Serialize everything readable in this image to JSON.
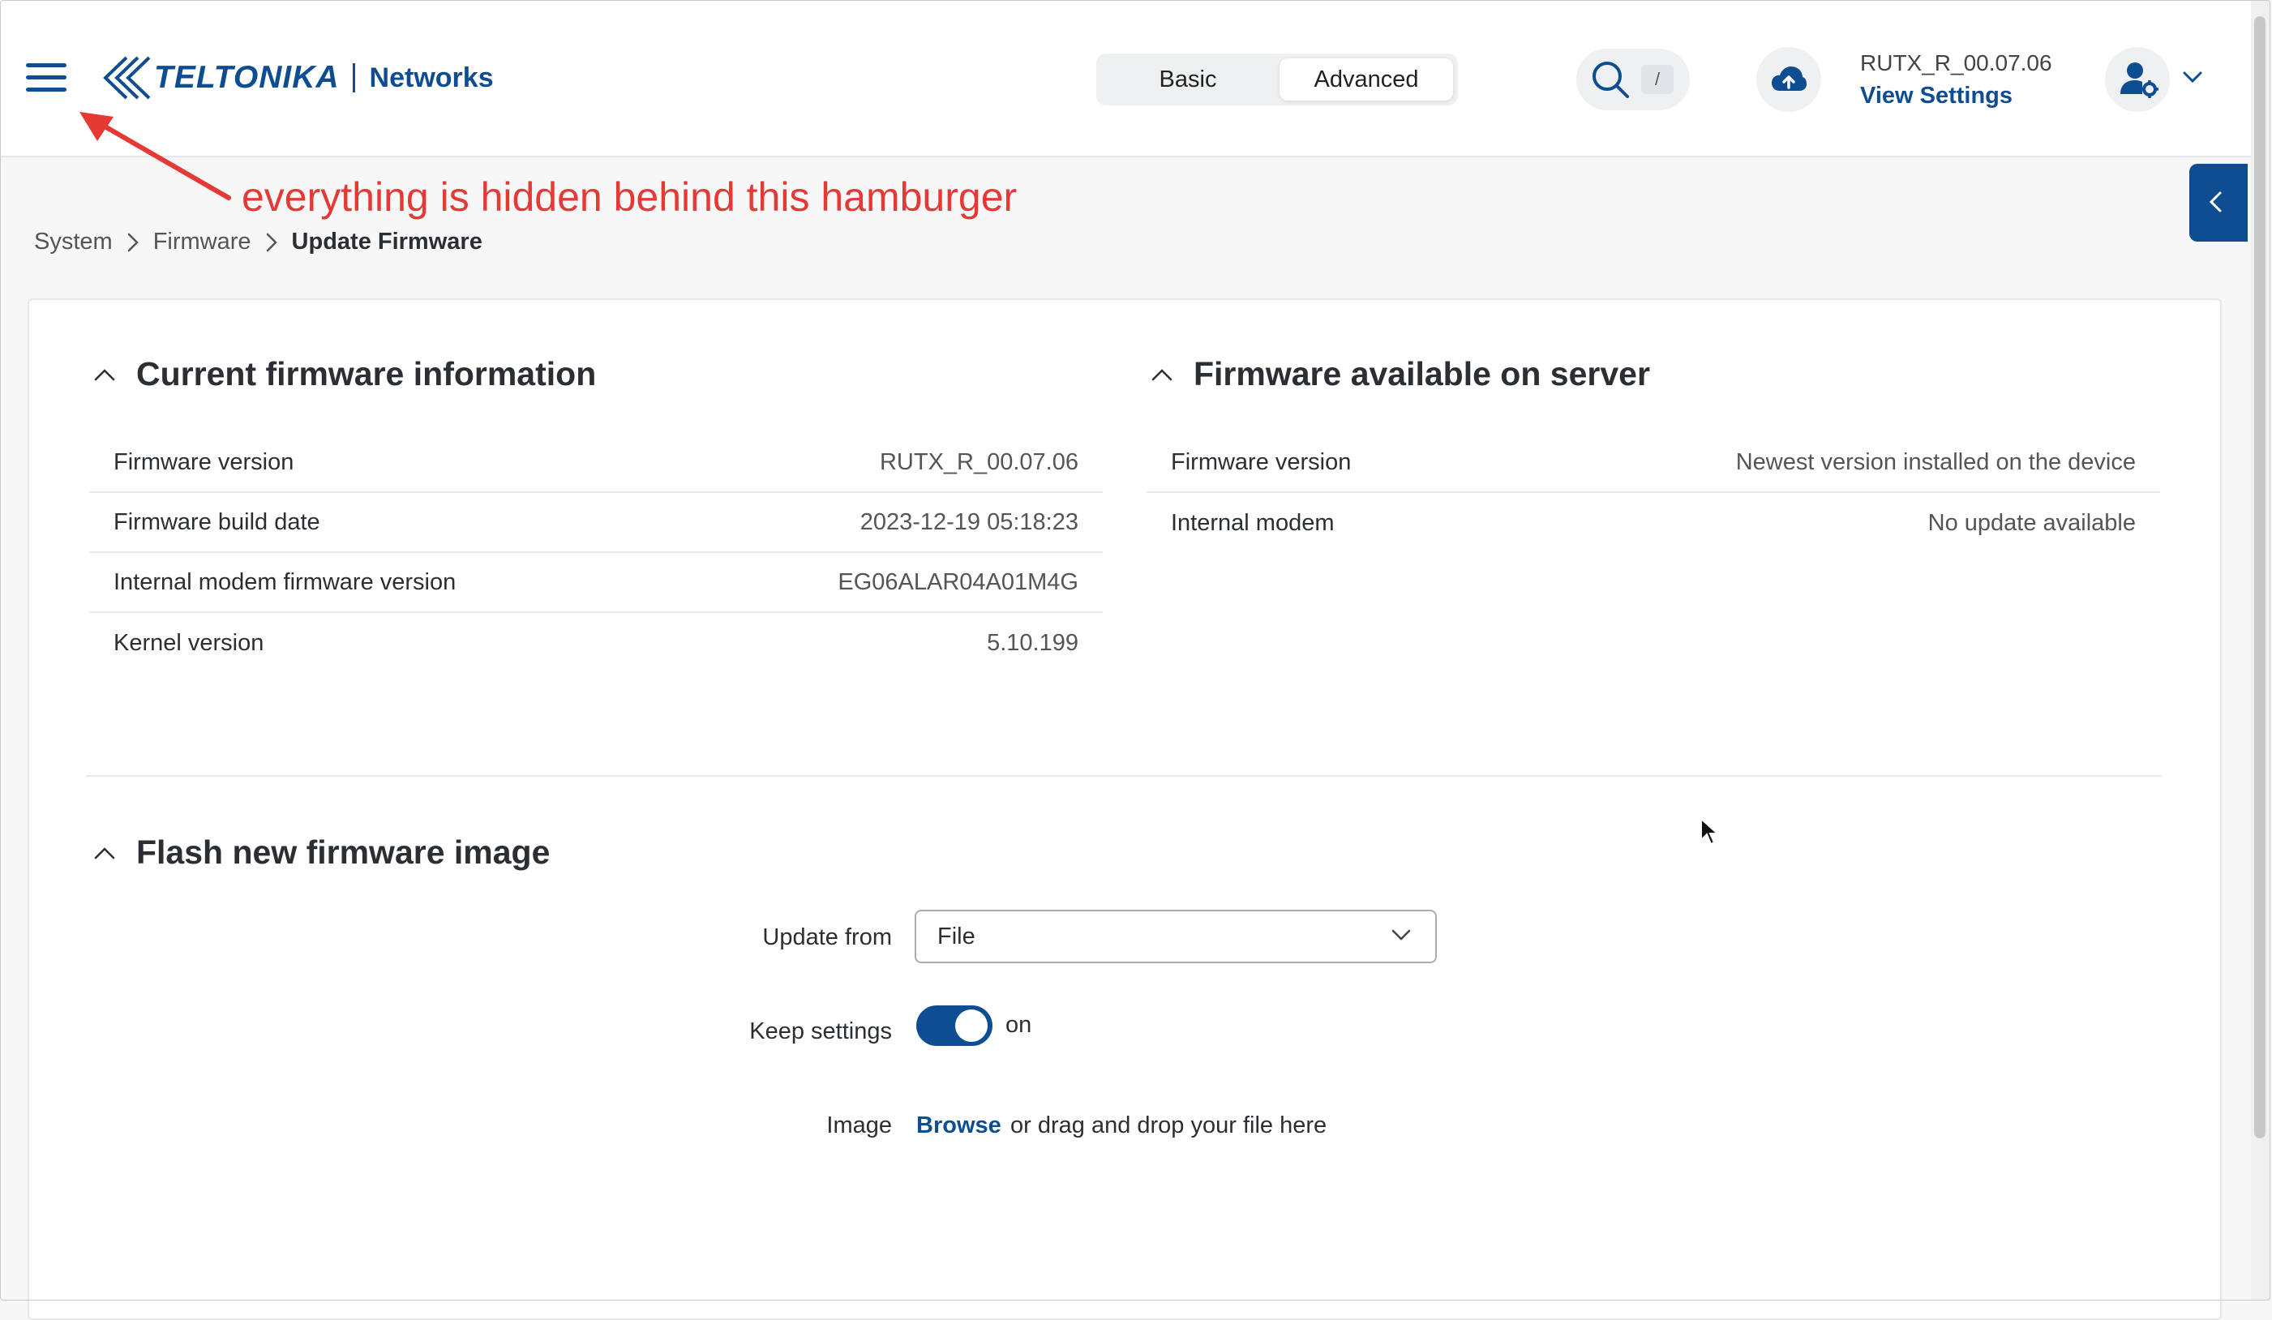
{
  "header": {
    "logo_text": "TELTONIKA",
    "logo_sub": "Networks",
    "modes": {
      "basic": "Basic",
      "advanced": "Advanced"
    },
    "search_shortcut": "/",
    "firmware_version": "RUTX_R_00.07.06",
    "view_settings": "View Settings"
  },
  "annotation": {
    "text": "everything is hidden behind this hamburger",
    "color": "#e53935"
  },
  "breadcrumb": {
    "items": [
      "System",
      "Firmware"
    ],
    "current": "Update Firmware"
  },
  "current_firmware": {
    "title": "Current firmware information",
    "rows": [
      {
        "label": "Firmware version",
        "value": "RUTX_R_00.07.06"
      },
      {
        "label": "Firmware build date",
        "value": "2023-12-19 05:18:23"
      },
      {
        "label": "Internal modem firmware version",
        "value": "EG06ALAR04A01M4G"
      },
      {
        "label": "Kernel version",
        "value": "5.10.199"
      }
    ]
  },
  "server_firmware": {
    "title": "Firmware available on server",
    "rows": [
      {
        "label": "Firmware version",
        "value": "Newest version installed on the device"
      },
      {
        "label": "Internal modem",
        "value": "No update available"
      }
    ]
  },
  "flash": {
    "title": "Flash new firmware image",
    "update_from_label": "Update from",
    "update_from_value": "File",
    "keep_settings_label": "Keep settings",
    "keep_settings_state": "on",
    "image_label": "Image",
    "browse": "Browse",
    "drop_text": "or drag and drop your file here"
  },
  "colors": {
    "brand": "#0e4d92",
    "annotation": "#e53935"
  }
}
